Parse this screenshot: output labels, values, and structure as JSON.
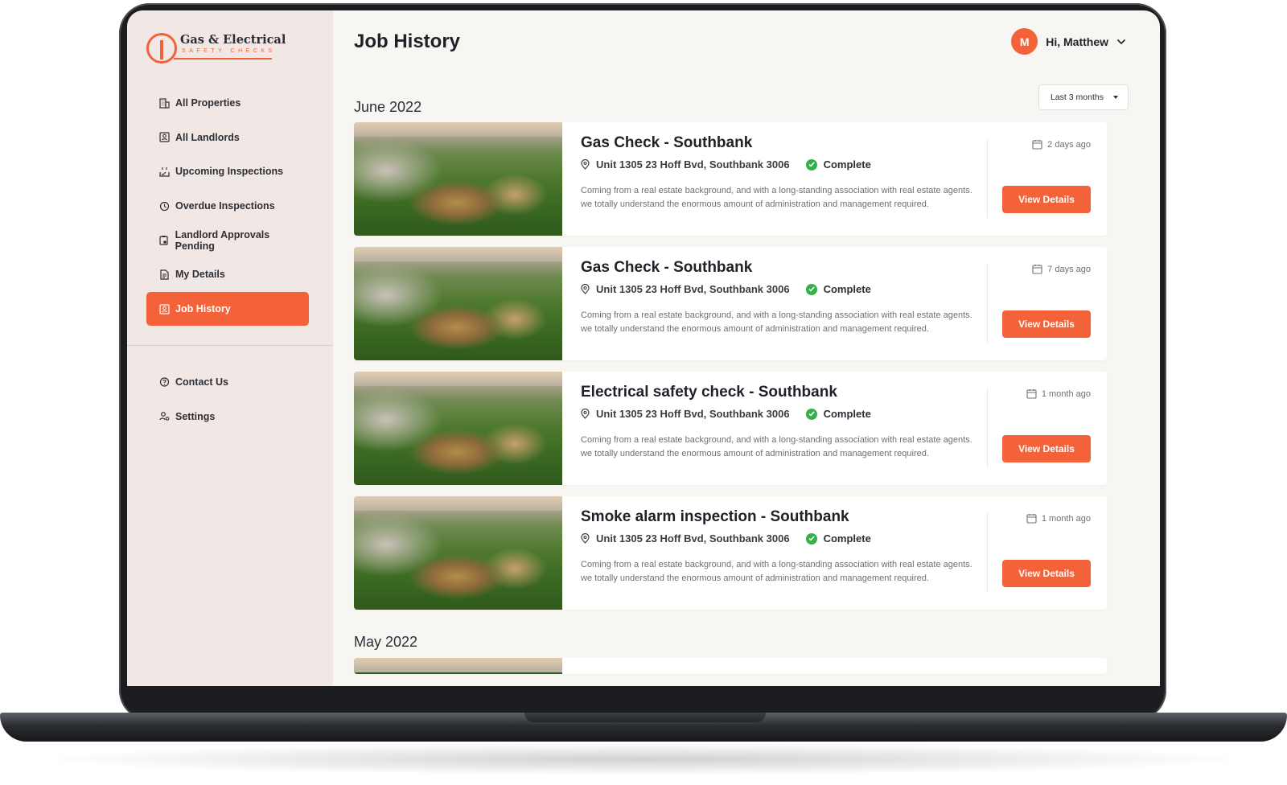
{
  "brand": {
    "name": "Gas & Electrical",
    "tagline": "SAFETY CHECKS",
    "accent_color": "#f4623a"
  },
  "sidebar": {
    "items": [
      {
        "label": "All Properties",
        "icon": "building-icon"
      },
      {
        "label": "All Landlords",
        "icon": "id-card-icon"
      },
      {
        "label": "Upcoming Inspections",
        "icon": "calendar-upcoming-icon"
      },
      {
        "label": "Overdue Inspections",
        "icon": "history-icon"
      },
      {
        "label": "Landlord Approvals Pending",
        "icon": "clipboard-icon"
      },
      {
        "label": "My Details",
        "icon": "document-icon"
      },
      {
        "label": "Job History",
        "icon": "id-card-icon",
        "active": true
      }
    ],
    "secondary_items": [
      {
        "label": "Contact Us",
        "icon": "help-icon"
      },
      {
        "label": "Settings",
        "icon": "user-settings-icon"
      }
    ]
  },
  "header": {
    "title": "Job History",
    "user": {
      "initial": "M",
      "greeting": "Hi, Matthew"
    }
  },
  "filter": {
    "selected": "Last 3 months"
  },
  "groups": [
    {
      "month": "June 2022",
      "jobs": [
        {
          "title": "Gas Check - Southbank",
          "address": "Unit 1305 23 Hoff Bvd, Southbank 3006",
          "status": "Complete",
          "when": "2 days ago",
          "description": "Coming from a real estate background, and with a long-standing association with real estate agents. we totally understand the enormous amount of administration and management required.",
          "action": "View Details"
        },
        {
          "title": "Gas Check - Southbank",
          "address": "Unit 1305 23 Hoff Bvd, Southbank 3006",
          "status": "Complete",
          "when": "7 days ago",
          "description": "Coming from a real estate background, and with a long-standing association with real estate agents. we totally understand the enormous amount of administration and management required.",
          "action": "View Details"
        },
        {
          "title": "Electrical safety check - Southbank",
          "address": "Unit 1305 23 Hoff Bvd, Southbank 3006",
          "status": "Complete",
          "when": "1 month ago",
          "description": "Coming from a real estate background, and with a long-standing association with real estate agents. we totally understand the enormous amount of administration and management required.",
          "action": "View Details"
        },
        {
          "title": "Smoke alarm inspection - Southbank",
          "address": "Unit 1305 23 Hoff Bvd, Southbank 3006",
          "status": "Complete",
          "when": "1 month ago",
          "description": "Coming from a real estate background, and with a long-standing association with real estate agents. we totally understand the enormous amount of administration and management required.",
          "action": "View Details"
        }
      ]
    },
    {
      "month": "May 2022",
      "jobs": []
    }
  ]
}
